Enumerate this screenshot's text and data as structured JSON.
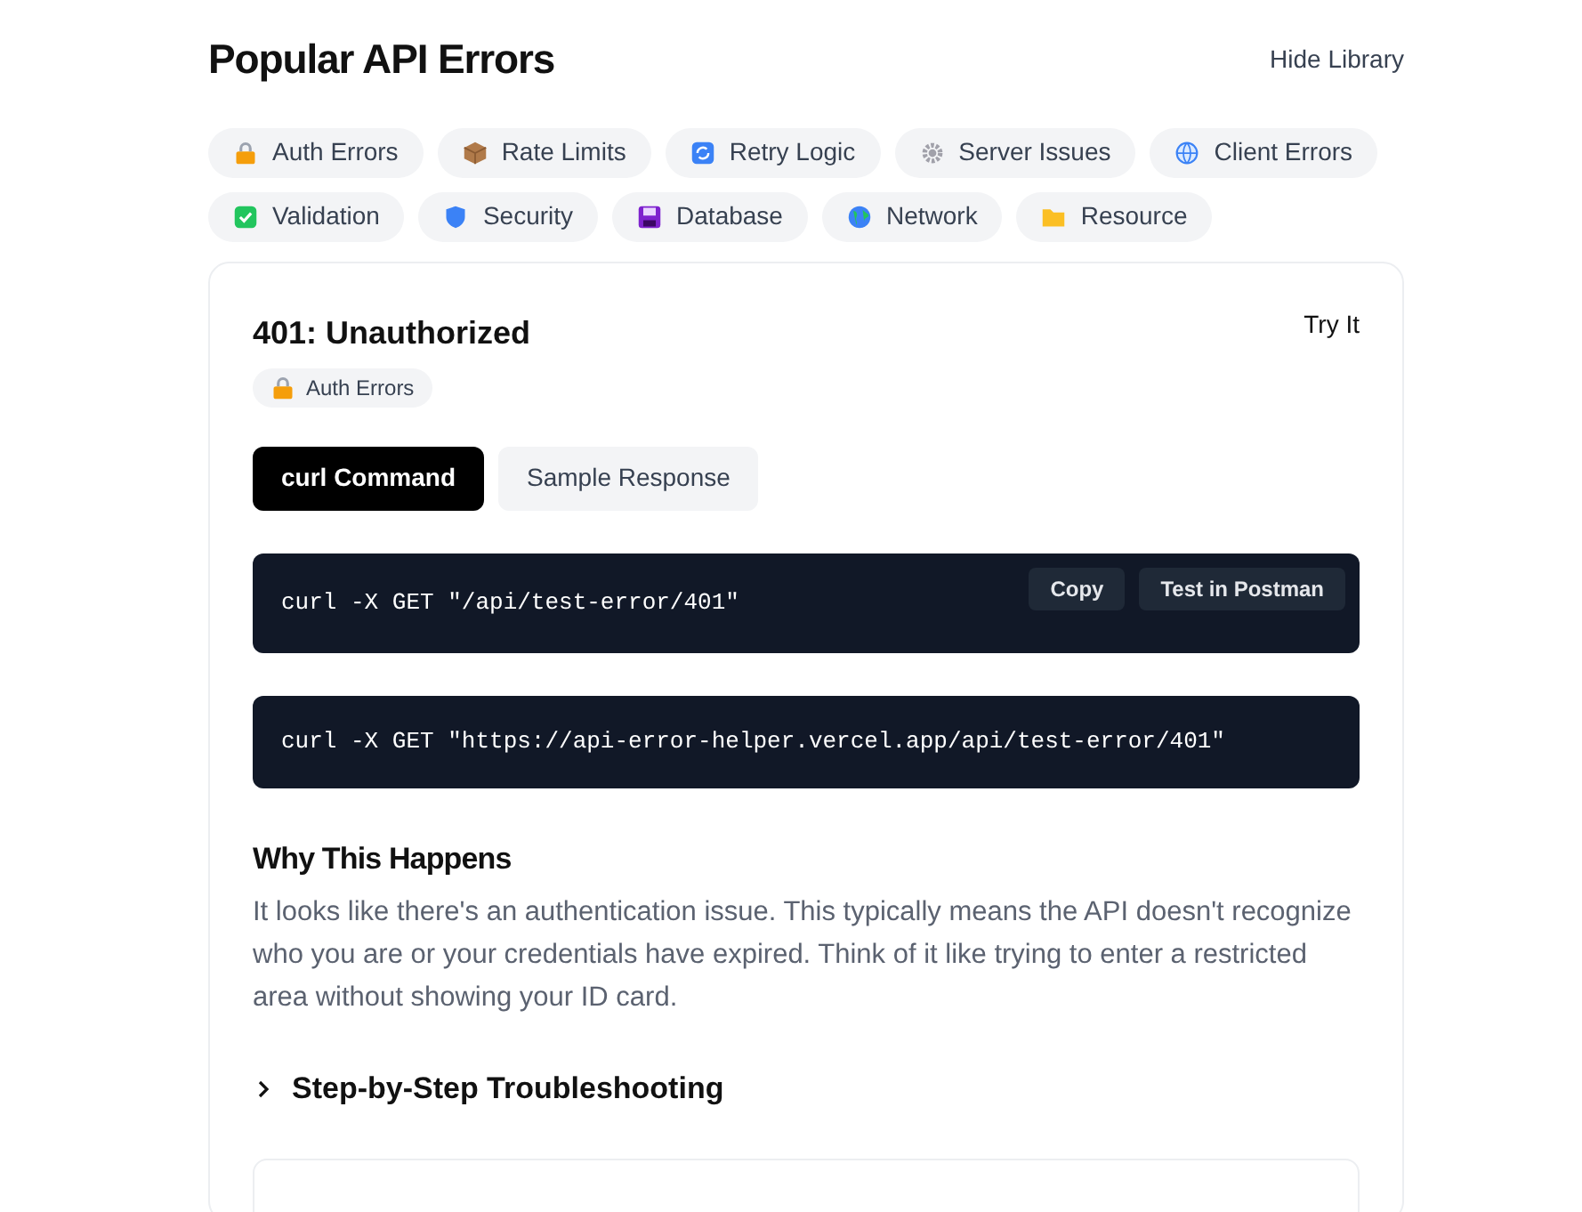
{
  "header": {
    "title": "Popular API Errors",
    "toggle": "Hide Library"
  },
  "categories": [
    {
      "label": "Auth Errors",
      "kind": "lock"
    },
    {
      "label": "Rate Limits",
      "kind": "box"
    },
    {
      "label": "Retry Logic",
      "kind": "retry"
    },
    {
      "label": "Server Issues",
      "kind": "gear"
    },
    {
      "label": "Client Errors",
      "kind": "globe"
    },
    {
      "label": "Validation",
      "kind": "check"
    },
    {
      "label": "Security",
      "kind": "shield"
    },
    {
      "label": "Database",
      "kind": "disk"
    },
    {
      "label": "Network",
      "kind": "earth"
    },
    {
      "label": "Resource",
      "kind": "folder"
    }
  ],
  "error": {
    "title": "401: Unauthorized",
    "try_it": "Try It",
    "tag": {
      "label": "Auth Errors",
      "kind": "lock"
    },
    "tabs": [
      {
        "label": "curl Command",
        "selected": true
      },
      {
        "label": "Sample Response",
        "selected": false
      }
    ],
    "commands": [
      {
        "code": "curl -X GET \"/api/test-error/401\"",
        "actions": [
          "Copy",
          "Test in Postman"
        ]
      },
      {
        "code": "curl -X GET \"https://api-error-helper.vercel.app/api/test-error/401\""
      }
    ],
    "why": {
      "heading": "Why This Happens",
      "text": "It looks like there's an authentication issue. This typically means the API doesn't recognize who you are or your credentials have expired. Think of it like trying to enter a restricted area without showing your ID card."
    },
    "troubleshooting": {
      "label": "Step-by-Step Troubleshooting",
      "expanded": false
    }
  }
}
